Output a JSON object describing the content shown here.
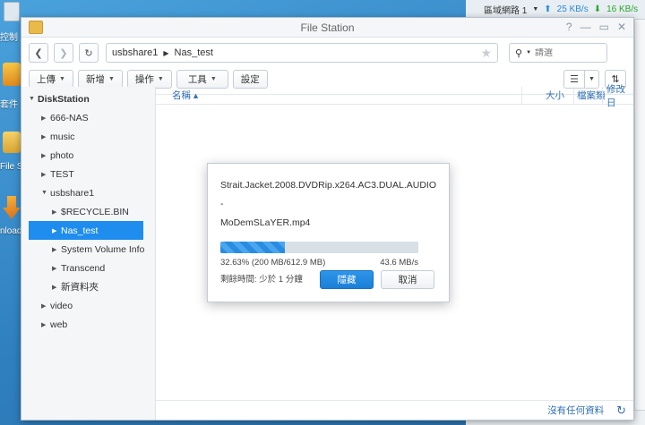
{
  "desktop": {
    "items": [
      {
        "label": "控制",
        "icon": "control-panel-icon"
      },
      {
        "label": "套件",
        "icon": "package-center-icon"
      },
      {
        "label": "File St",
        "icon": "file-station-icon"
      },
      {
        "label": "nload",
        "icon": "download-station-icon"
      }
    ]
  },
  "network_widget": {
    "label": "區域網路 1",
    "upload": "25 KB/s",
    "download": "16 KB/s"
  },
  "window": {
    "title": "File Station",
    "controls": [
      "?",
      "—",
      "▭",
      "✕"
    ]
  },
  "path": {
    "segments": [
      "usbshare1",
      "Nas_test"
    ]
  },
  "search": {
    "placeholder": "請選"
  },
  "toolbar": {
    "upload": "上傳",
    "create": "新增",
    "action": "操作",
    "tools": "工具",
    "settings": "設定"
  },
  "tree": {
    "root": "DiskStation",
    "nodes": [
      {
        "label": "666-NAS",
        "level": 1,
        "expanded": false
      },
      {
        "label": "music",
        "level": 1,
        "expanded": false
      },
      {
        "label": "photo",
        "level": 1,
        "expanded": false
      },
      {
        "label": "TEST",
        "level": 1,
        "expanded": false
      },
      {
        "label": "usbshare1",
        "level": 1,
        "expanded": true
      },
      {
        "label": "$RECYCLE.BIN",
        "level": 2,
        "expanded": false
      },
      {
        "label": "Nas_test",
        "level": 2,
        "expanded": false,
        "selected": true
      },
      {
        "label": "System Volume Info",
        "level": 2,
        "expanded": false
      },
      {
        "label": "Transcend",
        "level": 2,
        "expanded": false
      },
      {
        "label": "新資料夾",
        "level": 2,
        "expanded": false
      },
      {
        "label": "video",
        "level": 1,
        "expanded": false
      },
      {
        "label": "web",
        "level": 1,
        "expanded": false
      }
    ]
  },
  "columns": {
    "name": "名稱 ▴",
    "size": "大小",
    "type": "檔案類",
    "modified": "修改日"
  },
  "footer": {
    "status": "沒有任何資料"
  },
  "dialog": {
    "filename_line1": "Strait.Jacket.2008.DVDRip.x264.AC3.DUAL.AUDIO-",
    "filename_line2": "MoDemSLaYER.mp4",
    "progress_percent": 32.63,
    "progress_text": "32.63% (200 MB/612.9 MB)",
    "speed": "43.6 MB/s",
    "remaining": "剩餘時間: 少於 1 分鐘",
    "hide_label": "隱藏",
    "cancel_label": "取消"
  },
  "colors": {
    "accent": "#1f8ded",
    "link": "#2f6fb3"
  }
}
